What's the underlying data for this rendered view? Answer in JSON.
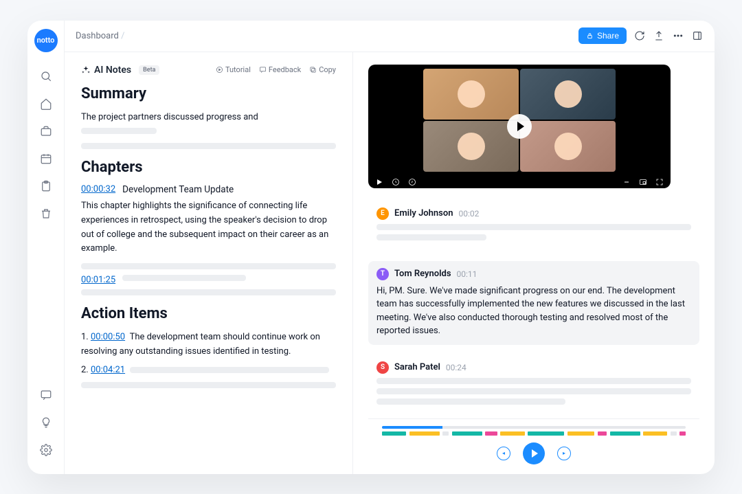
{
  "brand": "notto",
  "breadcrumb": "Dashboard",
  "share_label": "Share",
  "notes": {
    "title": "AI Notes",
    "badge": "Beta",
    "actions": {
      "tutorial": "Tutorial",
      "feedback": "Feedback",
      "copy": "Copy"
    }
  },
  "summary": {
    "heading": "Summary",
    "text": "The  project partners discussed progress and"
  },
  "chapters": {
    "heading": "Chapters",
    "items": [
      {
        "timestamp": "00:00:32",
        "title": "Development Team Update",
        "body": "This chapter highlights the significance of connecting life experiences in retrospect, using the speaker's decision to drop out of college and the subsequent impact on their career as an example."
      },
      {
        "timestamp": "00:01:25",
        "title": "",
        "body": ""
      }
    ]
  },
  "action_items": {
    "heading": "Action Items",
    "items": [
      {
        "index": "1.",
        "timestamp": "00:00:50",
        "text": "The development team should continue work on resolving any outstanding issues identified in testing."
      },
      {
        "index": "2.",
        "timestamp": "00:04:21",
        "text": ""
      }
    ]
  },
  "transcript": [
    {
      "initial": "E",
      "color": "orange",
      "name": "Emily Johnson",
      "time": "00:02",
      "text": "",
      "highlighted": false
    },
    {
      "initial": "T",
      "color": "purple",
      "name": "Tom Reynolds",
      "time": "00:11",
      "text": "Hi, PM. Sure. We've made significant progress on our end. The development team has successfully implemented the new features we discussed in the last meeting. We've also conducted thorough testing and resolved most of the reported issues.",
      "highlighted": true
    },
    {
      "initial": "S",
      "color": "red",
      "name": "Sarah Patel",
      "time": "00:24",
      "text": "",
      "highlighted": false
    }
  ]
}
